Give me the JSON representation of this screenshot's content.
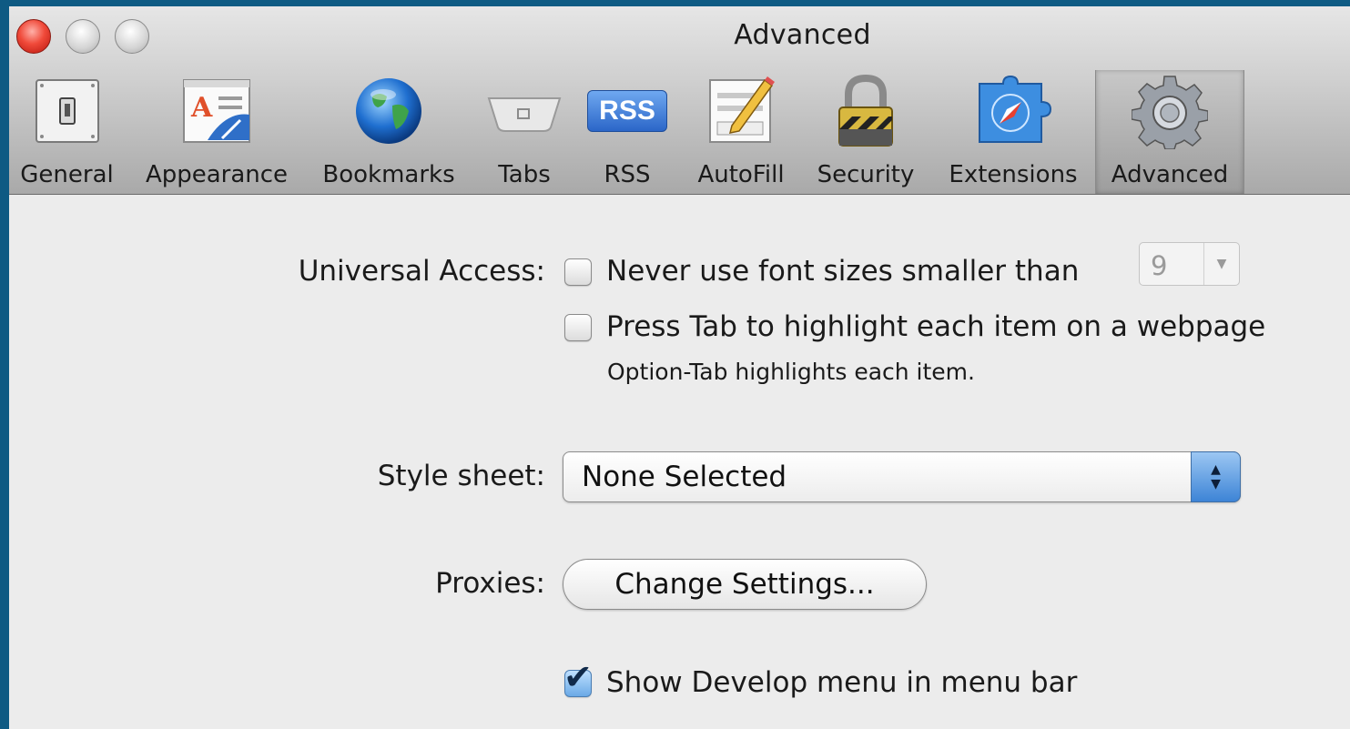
{
  "window": {
    "title": "Advanced"
  },
  "toolbar": {
    "items": [
      {
        "label": "General",
        "icon": "general-switch-icon"
      },
      {
        "label": "Appearance",
        "icon": "appearance-icon"
      },
      {
        "label": "Bookmarks",
        "icon": "globe-icon"
      },
      {
        "label": "Tabs",
        "icon": "tabs-icon"
      },
      {
        "label": "RSS",
        "icon": "rss-icon",
        "badge": "RSS"
      },
      {
        "label": "AutoFill",
        "icon": "autofill-pencil-icon"
      },
      {
        "label": "Security",
        "icon": "padlock-icon"
      },
      {
        "label": "Extensions",
        "icon": "extensions-puzzle-icon"
      },
      {
        "label": "Advanced",
        "icon": "gear-icon",
        "selected": true
      }
    ]
  },
  "universal_access": {
    "label": "Universal Access:",
    "min_font": {
      "text": "Never use font sizes smaller than",
      "checked": false,
      "value": "9"
    },
    "tab_highlight": {
      "text": "Press Tab to highlight each item on a webpage",
      "checked": false,
      "hint": "Option-Tab highlights each item."
    }
  },
  "style_sheet": {
    "label": "Style sheet:",
    "value": "None Selected"
  },
  "proxies": {
    "label": "Proxies:",
    "button": "Change Settings..."
  },
  "develop_menu": {
    "text": "Show Develop menu in menu bar",
    "checked": true
  },
  "colors": {
    "background": "#0e5a83",
    "window": "#ececec",
    "accent": "#3d84d6",
    "close_button": "#f04a3a"
  }
}
